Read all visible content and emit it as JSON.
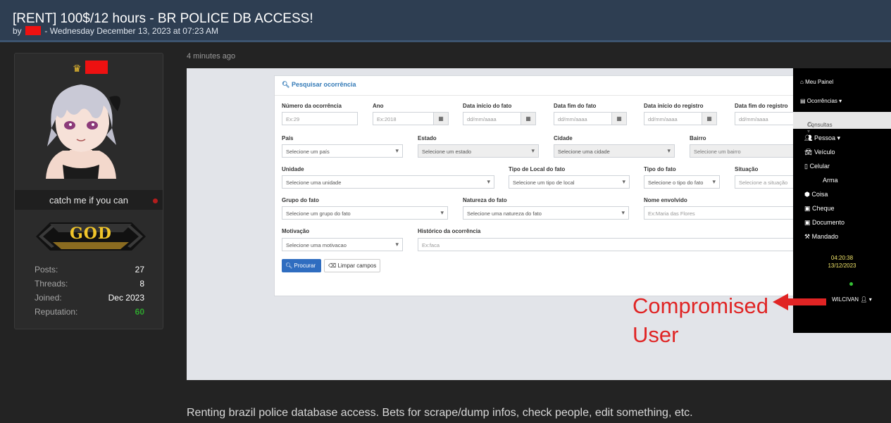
{
  "thread": {
    "title": "[RENT] 100$/12 hours - BR POLICE DB ACCESS!",
    "by_prefix": "by",
    "date": "- Wednesday December 13, 2023 at 07:23 AM"
  },
  "user": {
    "title": "catch me if you can",
    "rank_badge": "GOD",
    "stats": [
      {
        "label": "Posts:",
        "value": "27"
      },
      {
        "label": "Threads:",
        "value": "8"
      },
      {
        "label": "Joined:",
        "value": "Dec 2023"
      },
      {
        "label": "Reputation:",
        "value": "60"
      }
    ]
  },
  "post": {
    "time": "4 minutes ago",
    "text": "Renting brazil police database access. Bets for scrape/dump infos, check people, edit something, etc."
  },
  "screenshot": {
    "panel_title": "Pesquisar ocorrência",
    "fields": {
      "numero": {
        "label": "Número da ocorrência",
        "placeholder": "Ex:29"
      },
      "ano": {
        "label": "Ano",
        "placeholder": "Ex:2018"
      },
      "data_inicio_fato": {
        "label": "Data início do fato",
        "placeholder": "dd/mm/aaaa"
      },
      "data_fim_fato": {
        "label": "Data fim do fato",
        "placeholder": "dd/mm/aaaa"
      },
      "data_inicio_registro": {
        "label": "Data início do registro",
        "placeholder": "dd/mm/aaaa"
      },
      "data_fim_registro": {
        "label": "Data fim do registro",
        "placeholder": "dd/mm/aaaa"
      },
      "pais": {
        "label": "País",
        "value": "Selecione um país"
      },
      "estado": {
        "label": "Estado",
        "value": "Selecione um estado"
      },
      "cidade": {
        "label": "Cidade",
        "value": "Selecione uma cidade"
      },
      "bairro": {
        "label": "Bairro",
        "value": "Selecione um bairro"
      },
      "unidade": {
        "label": "Unidade",
        "value": "Selecione uma unidade"
      },
      "tipo_local": {
        "label": "Tipo de Local do fato",
        "value": "Selecione um tipo de local"
      },
      "tipo_fato": {
        "label": "Tipo do fato",
        "value": "Selecione o tipo do fato"
      },
      "situacao": {
        "label": "Situação",
        "value": "Selecione a situação"
      },
      "grupo": {
        "label": "Grupo do fato",
        "value": "Selecione um grupo do fato"
      },
      "natureza": {
        "label": "Natureza do fato",
        "value": "Selecione uma natureza do fato"
      },
      "nome": {
        "label": "Nome envolvido",
        "placeholder": "Ex:Maria das Flores"
      },
      "motivacao": {
        "label": "Motivação",
        "value": "Selecione uma motivacao"
      },
      "historico": {
        "label": "Histórico da ocorrência",
        "placeholder": "Ex:faca"
      }
    },
    "buttons": {
      "search": "Procurar",
      "clear": "Limpar campos"
    },
    "nav": {
      "meu_painel": "Meu Painel",
      "ocorrencias": "Ocorrências ▾",
      "consultas": "Consultas ▾",
      "items": [
        "Pessoa ▾",
        "Veículo",
        "Celular",
        "Arma",
        "Coisa",
        "Cheque",
        "Documento",
        "Mandado"
      ],
      "time": "04:20:38",
      "date": "13/12/2023",
      "user": "WILCIVAN"
    },
    "annotation": "Compromised User",
    "annotation_color": "#e02424"
  },
  "colors": {
    "header_bg": "#2e3e52",
    "page_bg": "#232323",
    "reputation": "#2ea42e"
  }
}
